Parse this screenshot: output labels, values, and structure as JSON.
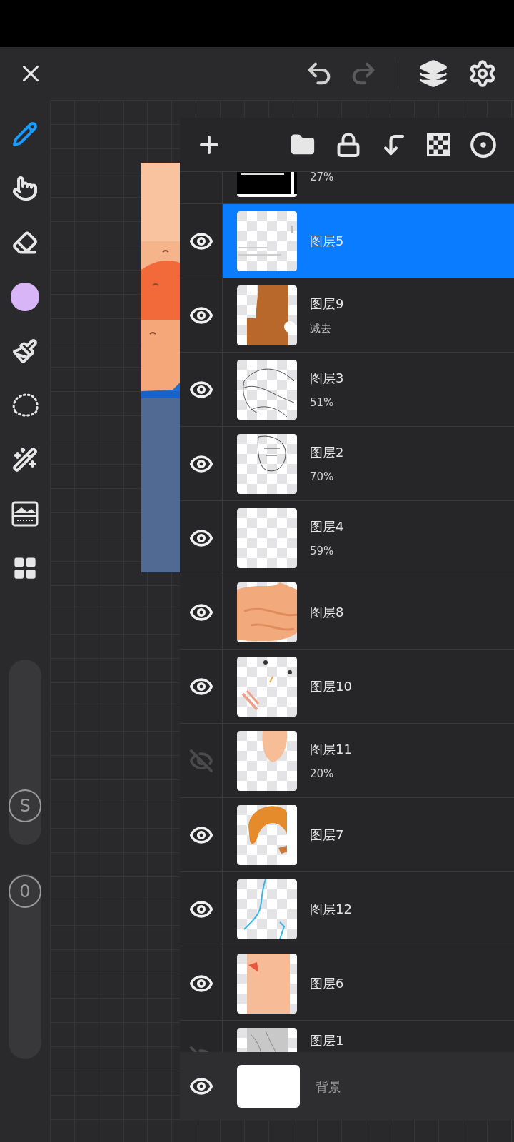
{
  "history": [
    {
      "kind": "undo",
      "disabled": false
    },
    {
      "kind": "redo",
      "disabled": true
    }
  ],
  "tools": [
    {
      "kind": "pencil",
      "selected": true
    },
    {
      "kind": "smudge",
      "selected": false
    },
    {
      "kind": "eraser",
      "selected": false
    },
    {
      "kind": "color",
      "selected": false,
      "color": "#d7b5f6"
    },
    {
      "kind": "brush",
      "selected": false
    },
    {
      "kind": "lasso",
      "selected": false
    },
    {
      "kind": "wand",
      "selected": false
    },
    {
      "kind": "adjust",
      "selected": false
    },
    {
      "kind": "gallery",
      "selected": false
    }
  ],
  "sliders": [
    {
      "label": "S",
      "level": 0.15
    },
    {
      "label": "0",
      "level": 0.99
    }
  ],
  "layers": [
    {
      "subtitle": "27%",
      "selected": false
    },
    {
      "name": "图层5",
      "visible": true,
      "selected": true
    },
    {
      "name": "图层9",
      "subtitle": "减去",
      "visible": true,
      "selected": false
    },
    {
      "name": "图层3",
      "subtitle": "51%",
      "visible": true,
      "selected": false
    },
    {
      "name": "图层2",
      "subtitle": "70%",
      "visible": true,
      "selected": false
    },
    {
      "name": "图层4",
      "subtitle": "59%",
      "visible": true,
      "selected": false
    },
    {
      "name": "图层8",
      "visible": true,
      "selected": false
    },
    {
      "name": "图层10",
      "visible": true,
      "selected": false
    },
    {
      "name": "图层11",
      "subtitle": "20%",
      "visible": false,
      "selected": false
    },
    {
      "name": "图层7",
      "visible": true,
      "selected": false
    },
    {
      "name": "图层12",
      "visible": true,
      "selected": false
    },
    {
      "name": "图层6",
      "visible": true,
      "selected": false
    },
    {
      "name": "图层1",
      "visible": false,
      "selected": false
    }
  ],
  "background_layer": {
    "name": "背景",
    "visible": true
  }
}
